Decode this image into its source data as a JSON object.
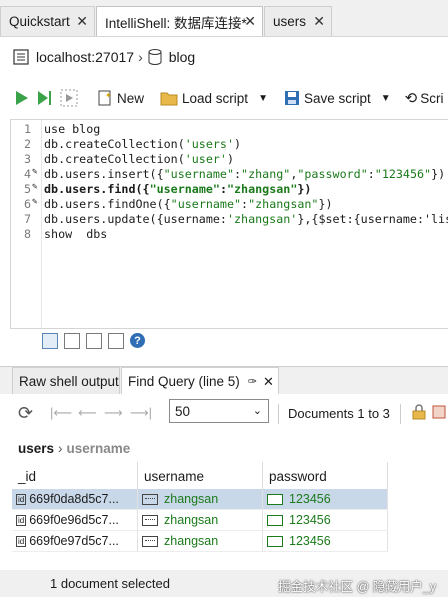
{
  "tabs": [
    {
      "label": "Quickstart",
      "close": "✕"
    },
    {
      "label": "IntelliShell: 数据库连接*",
      "close": "✕"
    },
    {
      "label": "users",
      "close": "✕"
    }
  ],
  "connection": {
    "host": "localhost:27017",
    "db": "blog"
  },
  "toolbar": {
    "new": "New",
    "load": "Load script",
    "save": "Save script",
    "script": "Scri"
  },
  "editor": {
    "lines": [
      {
        "n": "1",
        "text": "use blog"
      },
      {
        "n": "2",
        "text": "db.createCollection('users')"
      },
      {
        "n": "3",
        "text": "db.createCollection('user')"
      },
      {
        "n": "4",
        "text": "db.users.insert({\"username\":\"zhang\",\"password\":\"123456\"})"
      },
      {
        "n": "5",
        "text": "db.users.find({\"username\":\"zhangsan\"})"
      },
      {
        "n": "6",
        "text": "db.users.findOne({\"username\":\"zhangsan\"})"
      },
      {
        "n": "7",
        "text": "db.users.update({username:'zhangsan'},{$set:{username:'lis"
      },
      {
        "n": "8",
        "text": "show  dbs"
      }
    ]
  },
  "results": {
    "tabs": [
      {
        "label": "Raw shell output"
      },
      {
        "label": "Find Query (line 5)"
      }
    ],
    "page_size": "50",
    "documents": "Documents 1 to 3"
  },
  "breadcrumb": {
    "collection": "users",
    "field": "username"
  },
  "grid": {
    "columns": [
      "_id",
      "username",
      "password"
    ],
    "id_badge": "id",
    "rows": [
      {
        "id": "669f0da8d5c7...",
        "username": "zhangsan",
        "password": "123456"
      },
      {
        "id": "669f0e96d5c7...",
        "username": "zhangsan",
        "password": "123456"
      },
      {
        "id": "669f0e97d5c7...",
        "username": "zhangsan",
        "password": "123456"
      }
    ]
  },
  "status": {
    "text": "1 document selected",
    "watermark": "掘金技术社区 @ 隐藏用户_y"
  },
  "colors": {
    "selected_row": "#c9d8e8",
    "string_green": "#1b7a1b",
    "accent_blue": "#2f6db5"
  }
}
